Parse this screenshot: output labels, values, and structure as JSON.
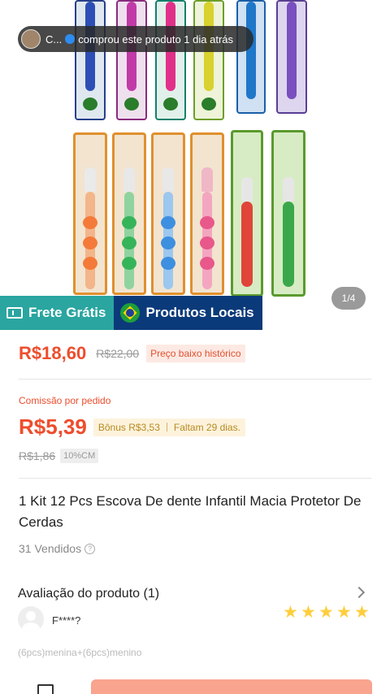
{
  "notification": {
    "user": "C...",
    "text": "comprou este produto 1 dia atrás"
  },
  "gallery": {
    "counter": "1/4"
  },
  "badges": {
    "frete": "Frete Grátis",
    "local": "Produtos Locais"
  },
  "price": {
    "current": "R$18,60",
    "original": "R$22,00",
    "tag": "Preço baixo histórico"
  },
  "commission": {
    "label": "Comissão por pedido",
    "amount": "R$5,39",
    "bonus": "Bônus R$3,53",
    "remaining": "Faltam 29 dias.",
    "old_amount": "R$1,86",
    "rate": "10%CM"
  },
  "product": {
    "title": "1 Kit 12 Pcs Escova De dente Infantil Macia Protetor De Cerdas",
    "sold": "31 Vendidos",
    "info_icon": "?"
  },
  "review": {
    "title": "Avaliação do produto (1)",
    "reviewer": "F****?",
    "rating": 5,
    "variant": "(6pcs)menina+(6pcs)menino"
  },
  "colors": {
    "accent": "#ee4d2d",
    "frete": "#2aa5a0",
    "local": "#0b3a7a",
    "star": "#ffce3d"
  }
}
